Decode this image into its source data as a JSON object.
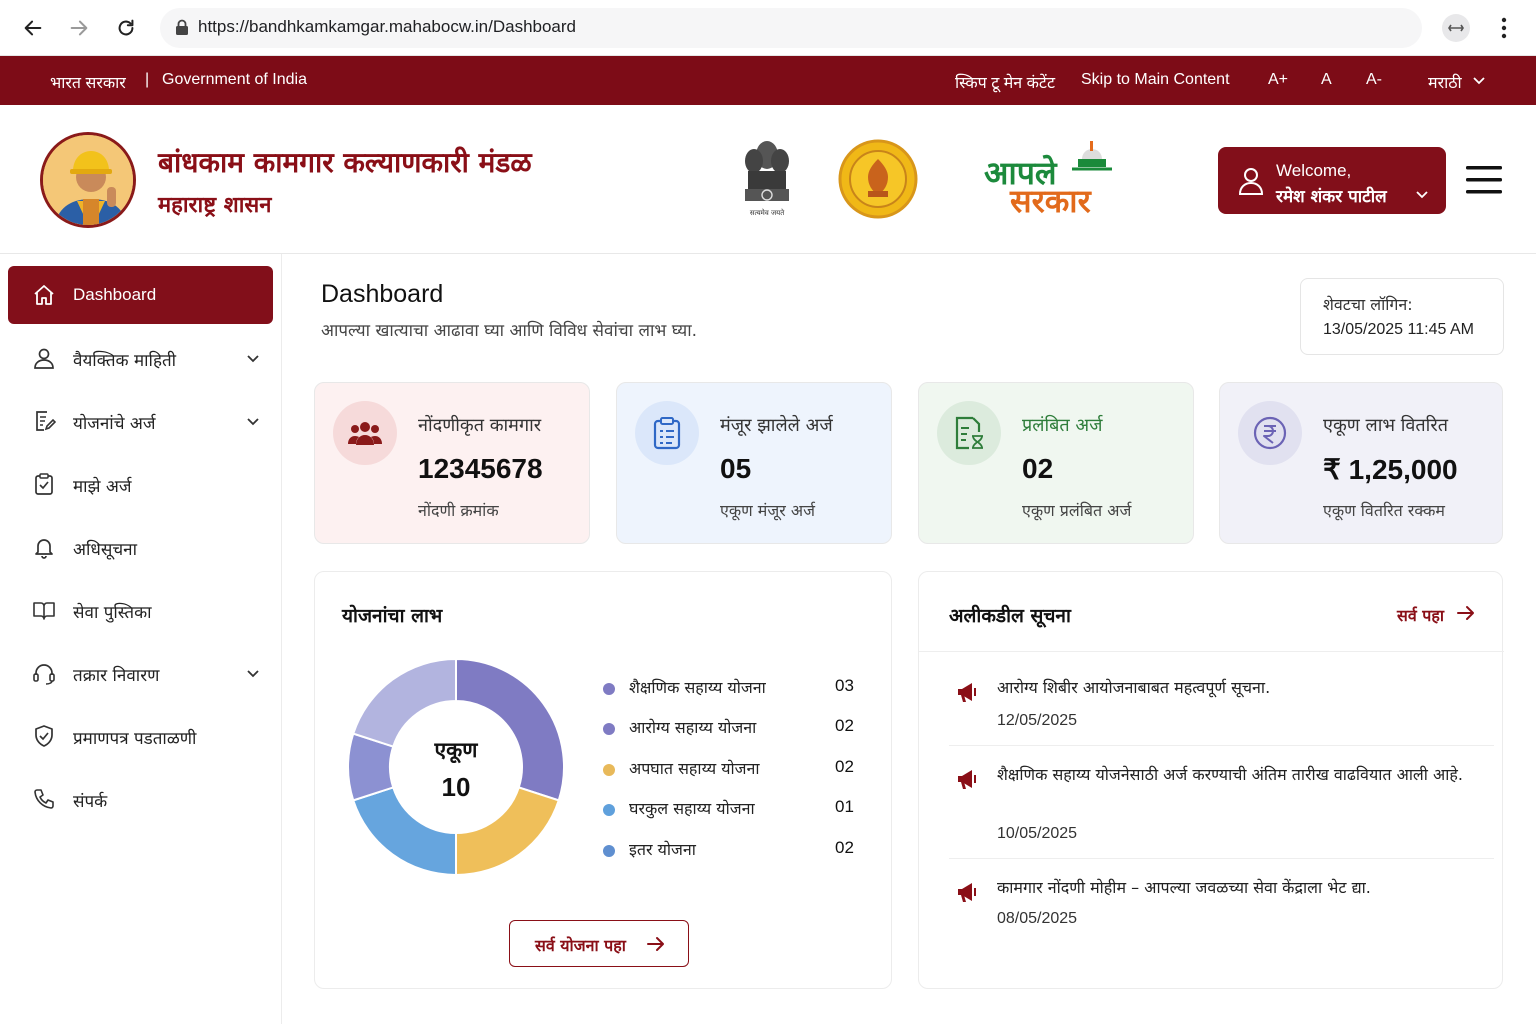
{
  "browser": {
    "url": "https://bandhkamkamgar.mahabocw.in/Dashboard"
  },
  "gov_bar": {
    "bharat_sarkar": "भारत सरकार",
    "separator": "|",
    "government_of_india": "Government of India",
    "skip_marathi": "स्किप टू मेन कंटेंट",
    "skip_english": "Skip to Main Content",
    "font_increase": "A+",
    "font_normal": "A",
    "font_decrease": "A-",
    "language": "मराठी"
  },
  "header": {
    "title": "बांधकाम कामगार कल्याणकारी मंडळ",
    "subtitle": "महाराष्ट्र शासन",
    "emblem_caption": "सत्यमेव जयते",
    "aaple_line1": "आपले",
    "aaple_line2": "सरकार",
    "welcome_label": "Welcome,",
    "user_name": "रमेश शंकर पाटील"
  },
  "sidebar": {
    "items": [
      {
        "label": "Dashboard",
        "icon": "home-icon",
        "active": true
      },
      {
        "label": "वैयक्तिक माहिती",
        "icon": "user-icon",
        "expandable": true
      },
      {
        "label": "योजनांचे अर्ज",
        "icon": "form-edit-icon",
        "expandable": true
      },
      {
        "label": "माझे अर्ज",
        "icon": "clipboard-icon"
      },
      {
        "label": "अधिसूचना",
        "icon": "bell-icon"
      },
      {
        "label": "सेवा पुस्तिका",
        "icon": "book-icon"
      },
      {
        "label": "तक्रार निवारण",
        "icon": "headset-icon",
        "expandable": true
      },
      {
        "label": "प्रमाणपत्र पडताळणी",
        "icon": "shield-check-icon"
      },
      {
        "label": "संपर्क",
        "icon": "phone-icon"
      }
    ]
  },
  "page": {
    "title": "Dashboard",
    "subtitle": "आपल्या खात्याचा आढावा घ्या आणि विविध सेवांचा लाभ घ्या.",
    "last_login_label": "शेवटचा लॉगिन:",
    "last_login_value": "13/05/2025 11:45 AM"
  },
  "stats": [
    {
      "title": "नोंदणीकृत कामगार",
      "value": "12345678",
      "sub": "नोंदणी क्रमांक",
      "icon": "users-icon",
      "bg": "#fdf1f1",
      "circle": "#f6dada",
      "accent": "#8a1a1a",
      "title_color": "#333"
    },
    {
      "title": "मंजूर झालेले अर्ज",
      "value": "05",
      "sub": "एकूण मंजूर अर्ज",
      "icon": "clipboard-list-icon",
      "bg": "#eef4fd",
      "circle": "#dbe7fa",
      "accent": "#2f68c6",
      "title_color": "#333"
    },
    {
      "title": "प्रलंबित अर्ज",
      "value": "02",
      "sub": "एकूण प्रलंबित अर्ज",
      "icon": "file-pending-icon",
      "bg": "#f0f7f0",
      "circle": "#dcebdd",
      "accent": "#2e7d3a",
      "title_color": "#2e7d3a"
    },
    {
      "title": "एकूण लाभ वितरित",
      "value": "₹ 1,25,000",
      "sub": "एकूण वितरित रक्कम",
      "icon": "rupee-icon",
      "bg": "#f1f1f8",
      "circle": "#e1e1f0",
      "accent": "#6b63b5",
      "title_color": "#333"
    }
  ],
  "benefits": {
    "title": "योजनांचा लाभ",
    "center_label": "एकूण",
    "center_value": "10",
    "button_label": "सर्व योजना पहा",
    "chart_data": {
      "type": "pie",
      "categories": [
        "शैक्षणिक सहाय्य योजना",
        "आरोग्य सहाय्य योजना",
        "अपघात सहाय्य योजना",
        "घरकुल सहाय्य योजना",
        "इतर योजना"
      ],
      "values": [
        3,
        2,
        2,
        1,
        2
      ],
      "labels": [
        "03",
        "02",
        "02",
        "01",
        "02"
      ],
      "legend_colors": [
        "#7f7bc3",
        "#7f7bc3",
        "#e8b95a",
        "#5fa0dc",
        "#5f8fd0"
      ],
      "legend": "right"
    }
  },
  "notices": {
    "title": "अलीकडील सूचना",
    "view_all": "सर्व पहा",
    "items": [
      {
        "text": "आरोग्य शिबीर आयोजनाबाबत महत्वपूर्ण सूचना.",
        "date": "12/05/2025"
      },
      {
        "text": "शैक्षणिक सहाय्य योजनेसाठी अर्ज करण्याची अंतिम तारीख वाढवियात आली आहे.",
        "date": "10/05/2025"
      },
      {
        "text": "कामगार नोंदणी मोहीम – आपल्या जवळच्या सेवा केंद्राला भेट द्या.",
        "date": "08/05/2025"
      }
    ]
  },
  "colors": {
    "brand": "#7d0c17",
    "brand_active": "#820f1a"
  }
}
